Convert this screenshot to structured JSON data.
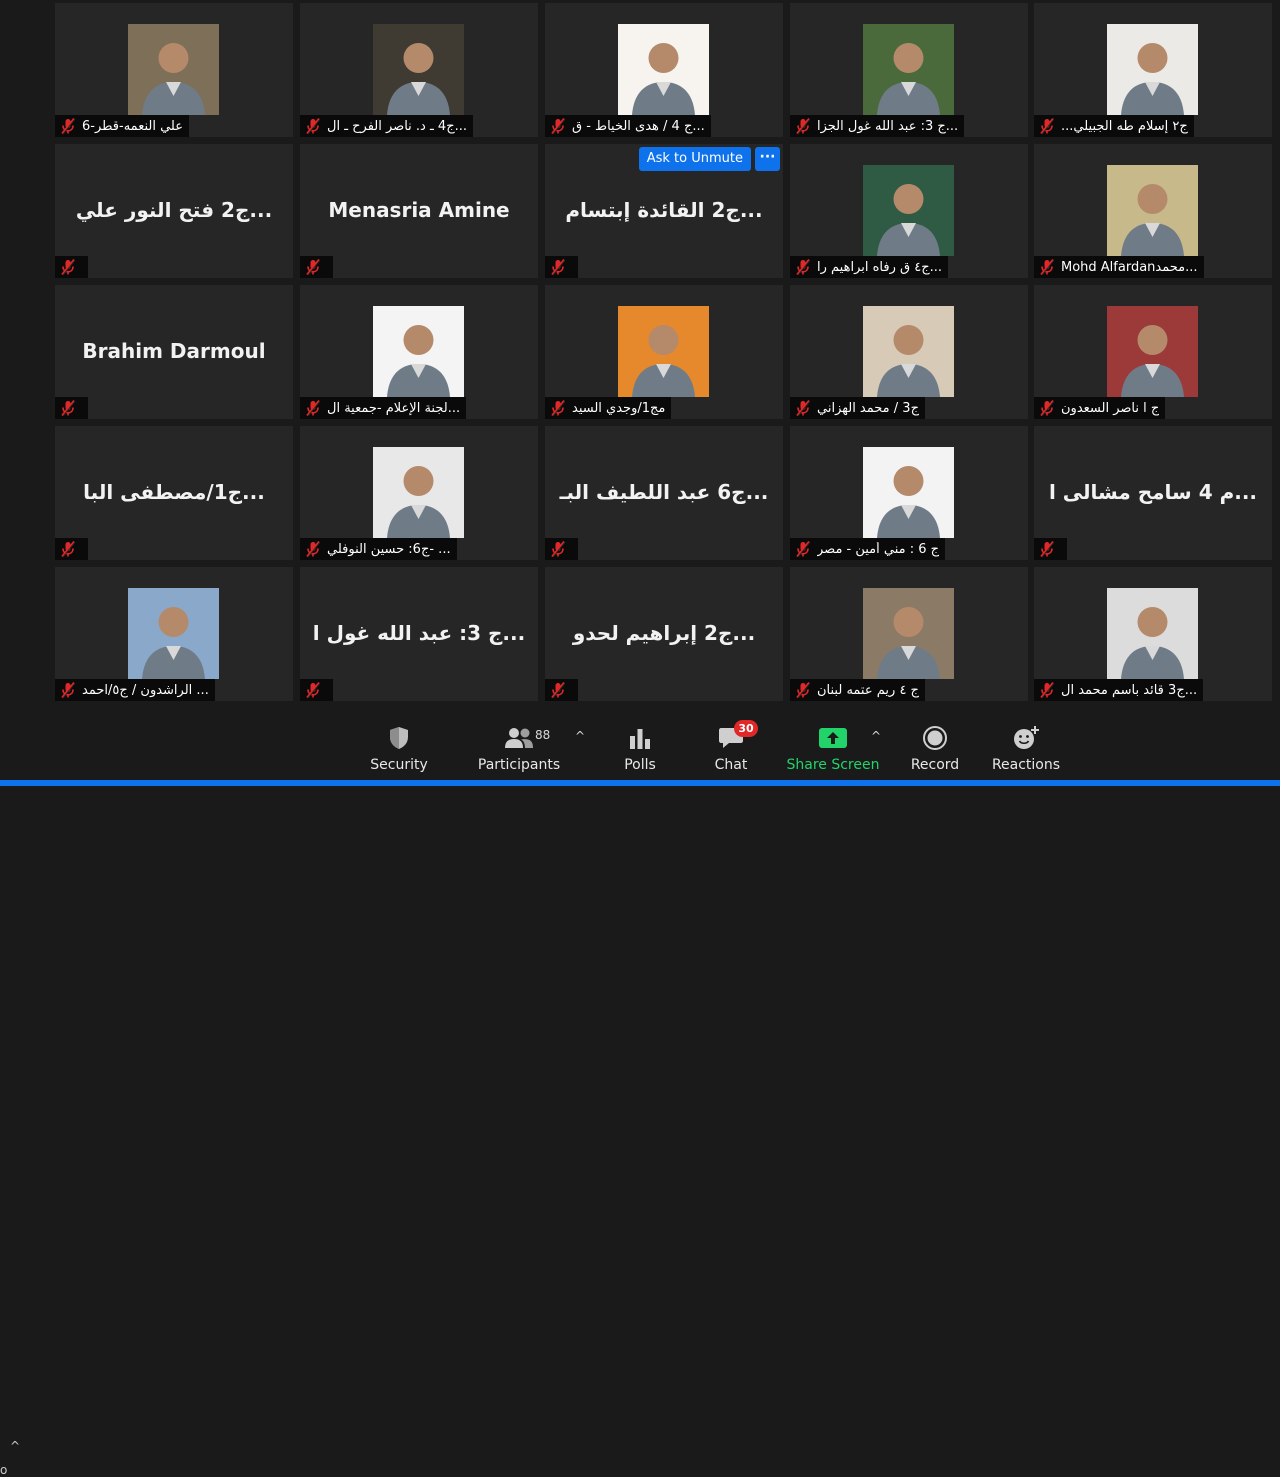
{
  "meeting": {
    "ask_to_unmute": "Ask to Unmute",
    "more_options": "···",
    "participants": [
      {
        "label": "علي النعمه-قطر-6",
        "photo": true,
        "bg": "#7e6f58"
      },
      {
        "label": "ج4 ـ د. ناصر الفرح ـ ال...",
        "photo": true,
        "bg": "#3f3b33"
      },
      {
        "label": "ج 4 / هدى الخياط - ق...",
        "photo": true,
        "bg": "#f7f4f0"
      },
      {
        "label": "ج 3: عبد الله غول الجزا...",
        "photo": true,
        "bg": "#4a6a3c"
      },
      {
        "label": "...ج٢ إسلام طه الجبيلي",
        "photo": true,
        "bg": "#eceae6"
      },
      {
        "label": "",
        "photo": false,
        "big_name": "ج2 فتح النور علي..."
      },
      {
        "label": "",
        "photo": false,
        "big_name": "Menasria Amine"
      },
      {
        "label": "",
        "photo": false,
        "big_name": "ج2 القائدة إبتسام...",
        "ask_unmute": true
      },
      {
        "label": "ج٤ ق رفاه ابراهيم را...",
        "photo": true,
        "bg": "#2f5a43"
      },
      {
        "label": "Mohd Alfardanمحمد...",
        "photo": true,
        "bg": "#c8b98b"
      },
      {
        "label": "",
        "photo": false,
        "big_name": "Brahim Darmoul"
      },
      {
        "label": "لجنة الإعلام -جمعية ال...",
        "photo": true,
        "bg": "#f4f4f4"
      },
      {
        "label": "مج1/وجدي السيد",
        "photo": true,
        "bg": "#e6882c"
      },
      {
        "label": "ج3 / محمد الهزاني",
        "photo": true,
        "bg": "#d7cbb8"
      },
      {
        "label": "ج ا ناصر السعدون",
        "photo": true,
        "bg": "#9c3a3a"
      },
      {
        "label": "",
        "photo": false,
        "big_name": "ج1/مصطفى البا..."
      },
      {
        "label": "ج6: حسين النوفلي- ...",
        "photo": true,
        "bg": "#e8e8e8"
      },
      {
        "label": "",
        "photo": false,
        "big_name": "ج6 عبد اللطيف البـ..."
      },
      {
        "label": "ج 6 : مني أمين - مصر",
        "photo": true,
        "bg": "#f3f3f3"
      },
      {
        "label": "",
        "photo": false,
        "big_name": "م 4 سامح مشالى ا..."
      },
      {
        "label": "الراشدون / ج٥/احمد ...",
        "photo": true,
        "bg": "#8aa8c9"
      },
      {
        "label": "",
        "photo": false,
        "big_name": "ج 3: عبد الله غول ا..."
      },
      {
        "label": "",
        "photo": false,
        "big_name": "ج2     إبراهيم لحدو..."
      },
      {
        "label": "ج ٤ ريم عتمه لبنان",
        "photo": true,
        "bg": "#8b7a66"
      },
      {
        "label": "ج3 قائد باسم محمد ال...",
        "photo": true,
        "bg": "#dcdcdc"
      }
    ]
  },
  "toolbar": {
    "edge_label": "o",
    "security": "Security",
    "participants": "Participants",
    "participants_count": "88",
    "polls": "Polls",
    "chat": "Chat",
    "chat_badge": "30",
    "share_screen": "Share Screen",
    "record": "Record",
    "reactions": "Reactions"
  },
  "colors": {
    "accent": "#0e72ed",
    "share_green": "#22d36a",
    "mute_red": "#e02828",
    "badge_red": "#e02828"
  }
}
